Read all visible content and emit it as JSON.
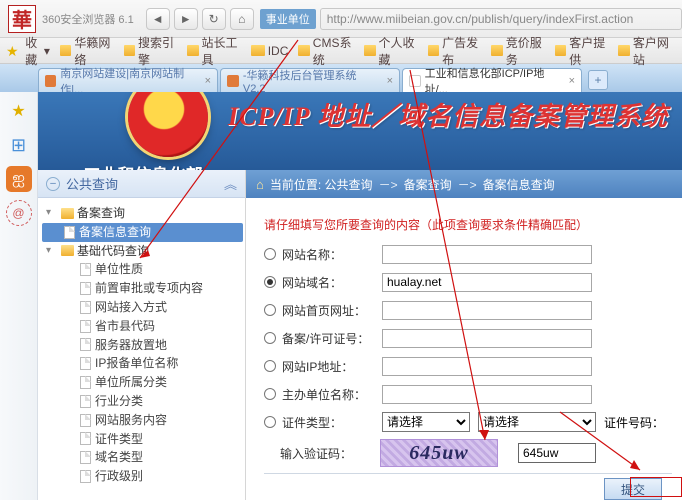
{
  "browser": {
    "title": "360安全浏览器 6.1",
    "logo_char": "華",
    "url_badge": "事业单位",
    "url": "http://www.miibeian.gov.cn/publish/query/indexFirst.action"
  },
  "bookmarks": [
    "收藏",
    "华籁网络",
    "搜索引擎",
    "站长工具",
    "IDC",
    "CMS系统",
    "个人收藏",
    "广告发布",
    "竞价服务",
    "客户提供",
    "客户网站"
  ],
  "tabs": {
    "t1": "南京网站建设|南京网站制作|...",
    "t2": "-华籁科技后台管理系统 V2.2",
    "t3": "工业和信息化部ICP/IP地址/..."
  },
  "banner": {
    "org": "工业和信息化部",
    "title": "ICP/IP 地址／域名信息备案管理系统"
  },
  "leftnav": {
    "header": "公共查询",
    "n_record_query": "备案查询",
    "n_record_info_query": "备案信息查询",
    "n_base_code_query": "基础代码查询",
    "items": [
      "单位性质",
      "前置审批或专项内容",
      "网站接入方式",
      "省市县代码",
      "服务器放置地",
      "IP报备单位名称",
      "单位所属分类",
      "行业分类",
      "网站服务内容",
      "证件类型",
      "域名类型",
      "行政级别"
    ]
  },
  "breadcrumb": {
    "loc_label": "当前位置:",
    "p1": "公共查询",
    "p2": "备案查询",
    "p3": "备案信息查询",
    "arrow": "－>"
  },
  "form": {
    "note": "请仔细填写您所要查询的内容（此项查询要求条件精确匹配）",
    "f_site_name": "网站名称：",
    "f_site_domain": "网站域名：",
    "f_site_url": "网站首页网址：",
    "f_record_no": "备案/许可证号：",
    "f_site_ip": "网站IP地址：",
    "f_org_name": "主办单位名称：",
    "f_cert_type": "证件类型：",
    "f_cert_no": "证件号码：",
    "f_captcha_label": "输入验证码：",
    "select_placeholder": "请选择",
    "domain_value": "hualay.net",
    "captcha_text": "645uw",
    "captcha_value": "645uw",
    "submit": "提交"
  }
}
